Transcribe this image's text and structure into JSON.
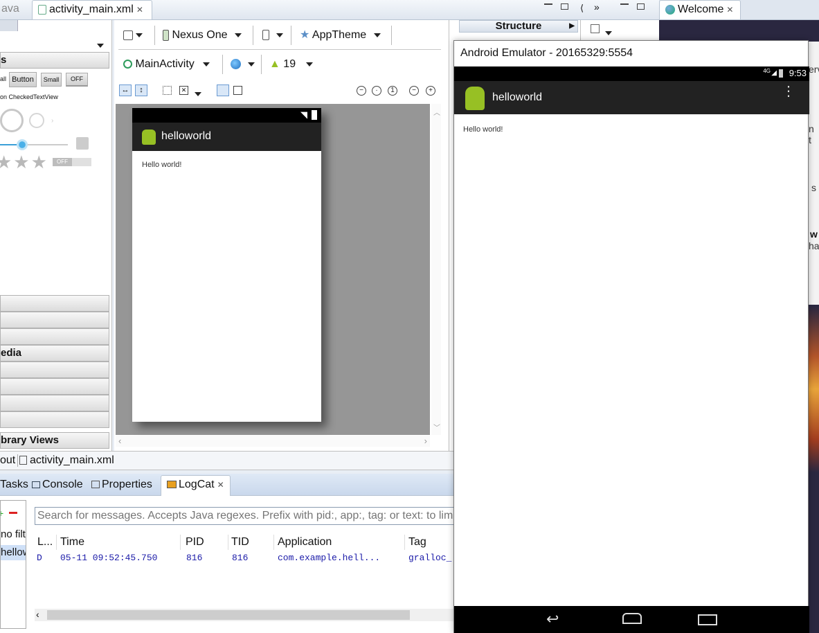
{
  "tabs": {
    "partial_left": "ava",
    "activity_main": "activity_main.xml",
    "structure": "Structure",
    "welcome": "Welcome"
  },
  "palette": {
    "section_widgets": "s",
    "btn_small_left": "all",
    "btn_button": "Button",
    "btn_small": "Small",
    "btn_off": "OFF",
    "text_checked": "on  CheckedTextView",
    "toggle_off": "OFF",
    "section_media": "edia",
    "section_library": "brary Views"
  },
  "toolbar": {
    "device": "Nexus One",
    "theme": "AppTheme",
    "activity": "MainActivity",
    "api": "19"
  },
  "preview": {
    "app_title": "helloworld",
    "content_text": "Hello world!"
  },
  "editor_tabs": {
    "layout_partial": "out",
    "xml": "activity_main.xml"
  },
  "bottom_tabs": {
    "tasks": "Tasks",
    "console": "Console",
    "properties": "Properties",
    "logcat": "LogCat"
  },
  "logcat": {
    "search_placeholder": "Search for messages. Accepts Java regexes. Prefix with pid:, app:, tag: or text: to lim",
    "filter_1": "no filt",
    "filter_2": "hellow",
    "columns": [
      "L...",
      "Time",
      "PID",
      "TID",
      "Application",
      "Tag"
    ],
    "rows": [
      {
        "level": "D",
        "time": "05-11 09:52:45.750",
        "pid": "816",
        "tid": "816",
        "app": "com.example.hell...",
        "tag": "gralloc_"
      }
    ]
  },
  "emulator": {
    "title": "Android Emulator - 20165329:5554",
    "network": "4G",
    "clock": "9:53",
    "app_title": "helloworld",
    "content_text": "Hello world!"
  },
  "right_partial": {
    "t1": "erv",
    "t2": "n t",
    "t3": "s",
    "t4": "w",
    "t5": "ha"
  },
  "colors": {
    "accent_blue": "#2f6fd6",
    "android_green": "#97c024",
    "action_bar": "#222222"
  }
}
